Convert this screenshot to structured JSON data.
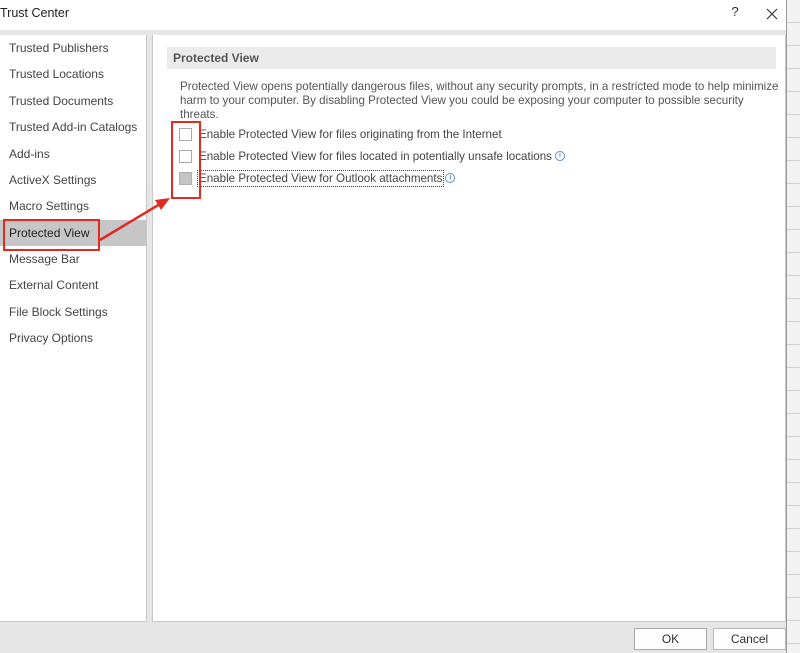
{
  "window": {
    "title": "Trust Center",
    "help_label": "?",
    "close_icon": "close-icon"
  },
  "sidebar": {
    "items": [
      {
        "label": "Trusted Publishers",
        "selected": false
      },
      {
        "label": "Trusted Locations",
        "selected": false
      },
      {
        "label": "Trusted Documents",
        "selected": false
      },
      {
        "label": "Trusted Add-in Catalogs",
        "selected": false
      },
      {
        "label": "Add-ins",
        "selected": false
      },
      {
        "label": "ActiveX Settings",
        "selected": false
      },
      {
        "label": "Macro Settings",
        "selected": false
      },
      {
        "label": "Protected View",
        "selected": true
      },
      {
        "label": "Message Bar",
        "selected": false
      },
      {
        "label": "External Content",
        "selected": false
      },
      {
        "label": "File Block Settings",
        "selected": false
      },
      {
        "label": "Privacy Options",
        "selected": false
      }
    ]
  },
  "main": {
    "section_title": "Protected View",
    "description": "Protected View opens potentially dangerous files, without any security prompts, in a restricted mode to help minimize harm to your computer. By disabling Protected View you could be exposing your computer to possible security threats.",
    "options": [
      {
        "label": "Enable Protected View for files originating from the Internet",
        "checked": false,
        "disabled": false,
        "info_icon": false
      },
      {
        "label": "Enable Protected View for files located in potentially unsafe locations",
        "checked": false,
        "disabled": false,
        "info_icon": true
      },
      {
        "label": "Enable Protected View for Outlook attachments",
        "checked": false,
        "disabled": true,
        "info_icon": true
      }
    ]
  },
  "footer": {
    "ok_label": "OK",
    "cancel_label": "Cancel"
  },
  "annotations": {
    "highlight_color": "#e32a1f"
  }
}
